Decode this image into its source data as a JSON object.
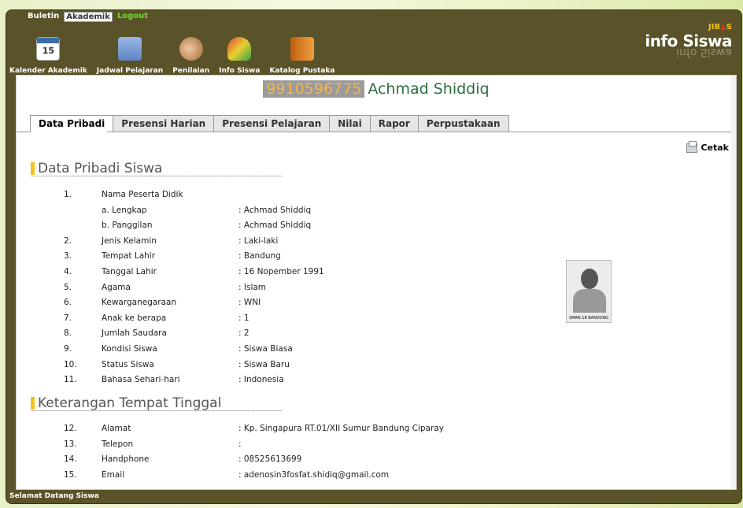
{
  "topnav": {
    "buletin": "Buletin",
    "akademik": "Akademik",
    "logout": "Logout"
  },
  "toolbar": [
    {
      "label": "Kalender Akademik",
      "icon": "calendar-icon",
      "icon_text": "15"
    },
    {
      "label": "Jadwal Pelajaran",
      "icon": "notebook-icon"
    },
    {
      "label": "Penilaian",
      "icon": "handshake-icon"
    },
    {
      "label": "Info Siswa",
      "icon": "figure-icon"
    },
    {
      "label": "Katalog Pustaka",
      "icon": "book-icon"
    }
  ],
  "brand": {
    "jibas": "JIB",
    "jibas_suffix": "S",
    "logo": "info Siswa",
    "mirror": "info Siswa"
  },
  "student": {
    "nis": "9910596775",
    "name": "Achmad Shiddiq"
  },
  "tabs": [
    "Data Pribadi",
    "Presensi Harian",
    "Presensi Pelajaran",
    "Nilai",
    "Rapor",
    "Perpustakaan"
  ],
  "print_label": "Cetak",
  "sections": {
    "pribadi": "Data Pribadi Siswa",
    "tinggal": "Keterangan Tempat Tinggal",
    "underline": "~~~~~~~~~~~~~~~~~~~~~~~~~~~~~~~~~~~~~~~~~~~~~~~~~~~~~~~~"
  },
  "pribadi_rows": [
    {
      "no": "1.",
      "label": "Nama Peserta Didik",
      "val": ""
    },
    {
      "no": "",
      "label": "a. Lengkap",
      "val": ": Achmad Shiddiq"
    },
    {
      "no": "",
      "label": "b. Panggilan",
      "val": ": Achmad Shiddiq"
    },
    {
      "no": "2.",
      "label": "Jenis Kelamin",
      "val": ": Laki-laki"
    },
    {
      "no": "3.",
      "label": "Tempat Lahir",
      "val": ": Bandung"
    },
    {
      "no": "4.",
      "label": "Tanggal Lahir",
      "val": ": 16 Nopember 1991"
    },
    {
      "no": "5.",
      "label": "Agama",
      "val": ": Islam"
    },
    {
      "no": "6.",
      "label": "Kewarganegaraan",
      "val": ": WNI"
    },
    {
      "no": "7.",
      "label": "Anak ke berapa",
      "val": ": 1"
    },
    {
      "no": "8.",
      "label": "Jumlah Saudara",
      "val": ": 2"
    },
    {
      "no": "9.",
      "label": "Kondisi Siswa",
      "val": ": Siswa Biasa"
    },
    {
      "no": "10.",
      "label": "Status Siswa",
      "val": ": Siswa Baru"
    },
    {
      "no": "11.",
      "label": "Bahasa Sehari-hari",
      "val": ": Indonesia"
    }
  ],
  "tinggal_rows": [
    {
      "no": "12.",
      "label": "Alamat",
      "val": ": Kp. Singapura RT.01/XII Sumur Bandung Ciparay"
    },
    {
      "no": "13.",
      "label": "Telepon",
      "val": ":"
    },
    {
      "no": "14.",
      "label": "Handphone",
      "val": ": 08525613699"
    },
    {
      "no": "15.",
      "label": "Email",
      "val": ": adenosin3fosfat.shidiq@gmail.com"
    }
  ],
  "photo_caption": "SMAN 18 BANDUNG",
  "status": "Selamat Datang Siswa"
}
